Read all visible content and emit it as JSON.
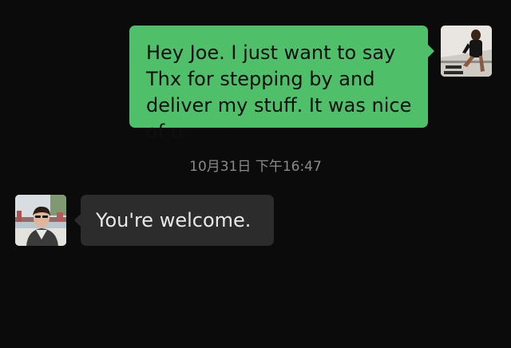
{
  "outgoing": {
    "text": "Hey Joe. I just want to say Thx for stepping by and deliver my stuff. It was nice of u",
    "bubble_color": "#4fbf6a",
    "avatar_icon": "user-avatar"
  },
  "timestamp": "10月31日 下午16:47",
  "incoming": {
    "text": "You're welcome.",
    "bubble_color": "#2c2c2c",
    "avatar_icon": "contact-avatar"
  }
}
